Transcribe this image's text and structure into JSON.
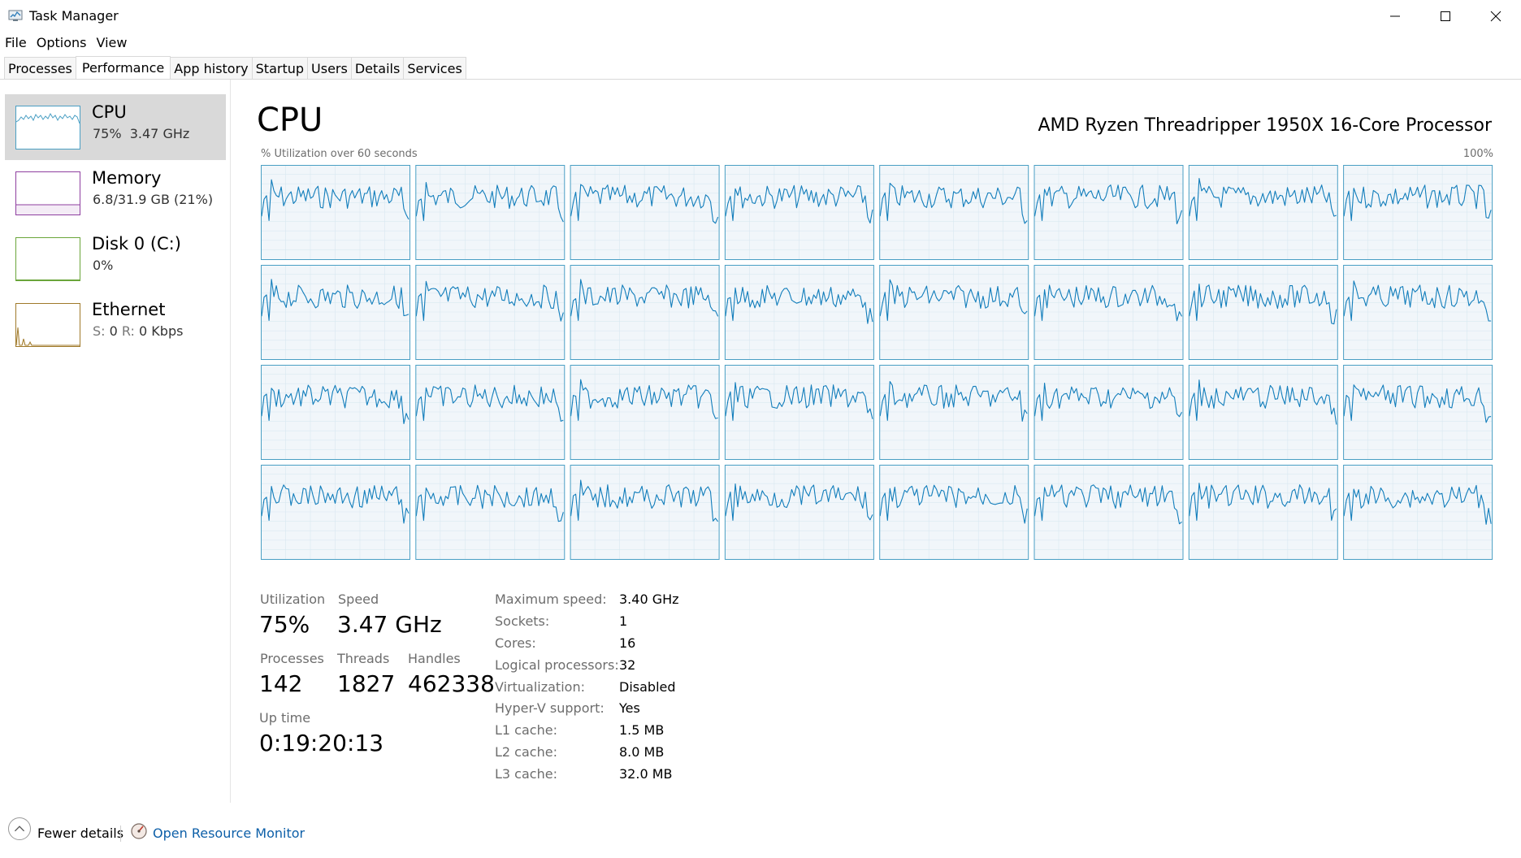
{
  "window": {
    "title": "Task Manager",
    "minimize_icon": "minimize-icon",
    "maximize_icon": "maximize-icon",
    "close_icon": "close-icon"
  },
  "menu": [
    "File",
    "Options",
    "View"
  ],
  "tabs": [
    "Processes",
    "Performance",
    "App history",
    "Startup",
    "Users",
    "Details",
    "Services"
  ],
  "active_tab": "Performance",
  "sidebar": [
    {
      "name": "CPU",
      "detail": "75%  3.47 GHz",
      "accent": "#4a9fc4",
      "selected": true
    },
    {
      "name": "Memory",
      "detail": "6.8/31.9 GB (21%)",
      "accent": "#8f3fa0",
      "selected": false
    },
    {
      "name": "Disk 0 (C:)",
      "detail": "0%",
      "accent": "#6aa53a",
      "selected": false
    },
    {
      "name": "Ethernet",
      "detail_s_label": "S:",
      "detail_s_value": "0",
      "detail_r_label": "R:",
      "detail_r_value": "0 Kbps",
      "accent": "#a07a2a",
      "selected": false
    }
  ],
  "main": {
    "title": "CPU",
    "processor": "AMD Ryzen Threadripper 1950X 16-Core Processor",
    "axis_left": "% Utilization over 60 seconds",
    "axis_right": "100%",
    "graph_line_color": "#117dbb",
    "graph_fill_color": "#f1f6fa",
    "graph_border_color": "#4a9fc4",
    "logical_processor_graphs": 32
  },
  "stats": {
    "utilization_label": "Utilization",
    "utilization_value": "75%",
    "speed_label": "Speed",
    "speed_value": "3.47 GHz",
    "processes_label": "Processes",
    "processes_value": "142",
    "threads_label": "Threads",
    "threads_value": "1827",
    "handles_label": "Handles",
    "handles_value": "462338",
    "uptime_label": "Up time",
    "uptime_value": "0:19:20:13"
  },
  "specs": [
    {
      "label": "Maximum speed:",
      "value": "3.40 GHz"
    },
    {
      "label": "Sockets:",
      "value": "1"
    },
    {
      "label": "Cores:",
      "value": "16"
    },
    {
      "label": "Logical processors:",
      "value": "32"
    },
    {
      "label": "Virtualization:",
      "value": "Disabled"
    },
    {
      "label": "Hyper-V support:",
      "value": "Yes"
    },
    {
      "label": "L1 cache:",
      "value": "1.5 MB"
    },
    {
      "label": "L2 cache:",
      "value": "8.0 MB"
    },
    {
      "label": "L3 cache:",
      "value": "32.0 MB"
    }
  ],
  "footer": {
    "fewer_details": "Fewer details",
    "fewer_icon": "chevron-up-circle-icon",
    "resource_monitor": "Open Resource Monitor",
    "resource_icon": "resource-monitor-icon"
  }
}
